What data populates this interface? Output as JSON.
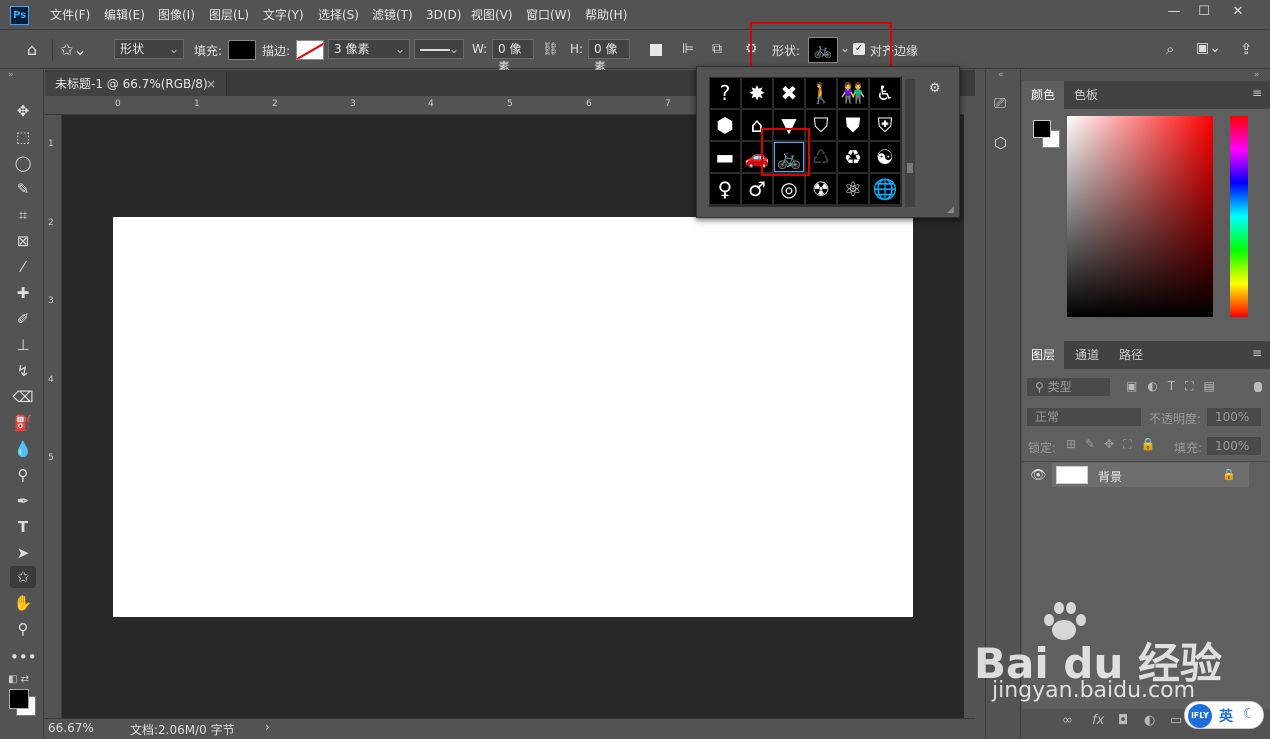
{
  "app": {
    "logo": "Ps"
  },
  "menu": [
    "文件(F)",
    "编辑(E)",
    "图像(I)",
    "图层(L)",
    "文字(Y)",
    "选择(S)",
    "滤镜(T)",
    "3D(D)",
    "视图(V)",
    "窗口(W)",
    "帮助(H)"
  ],
  "window_controls": {
    "minimize": "—",
    "maximize": "☐",
    "close": "✕"
  },
  "options": {
    "mode_value": "形状",
    "fill_label": "填充:",
    "stroke_label": "描边:",
    "stroke_width": "3 像素",
    "w_label": "W:",
    "w_value": "0 像素",
    "h_label": "H:",
    "h_value": "0 像素",
    "shape_label": "形状:",
    "align_edges_label": "对齐边缘",
    "align_edges_checked": true
  },
  "document": {
    "tab_title": "未标题-1 @ 66.7%(RGB/8)",
    "tab_close": "×",
    "ruler_top": [
      "0",
      "1",
      "2",
      "3",
      "4",
      "5",
      "6",
      "7"
    ],
    "ruler_left": [
      "1",
      "2",
      "3",
      "4",
      "5"
    ],
    "zoom": "66.67%",
    "doc_info": "文档:2.06M/0 字节",
    "status_arrow": "›"
  },
  "shape_picker": {
    "rows": [
      [
        "?",
        "✸",
        "✖",
        "🚶",
        "👫",
        "♿"
      ],
      [
        "⬢",
        "⌂",
        "▼",
        "⛉",
        "⛊",
        "⛨"
      ],
      [
        "▬",
        "🚗",
        "🚲",
        "♺",
        "♻",
        "☯"
      ],
      [
        "♀",
        "♂",
        "◎",
        "☢",
        "⚛",
        "🌐"
      ]
    ],
    "selected": "bicycle",
    "menu_icon": "⚙"
  },
  "color_panel": {
    "tabs": [
      "颜色",
      "色板"
    ],
    "foreground": "#000000",
    "background": "#ffffff",
    "hue_color": "#ff0000"
  },
  "layers_panel": {
    "tabs": [
      "图层",
      "通道",
      "路径"
    ],
    "filter_placeholder": "类型",
    "blend_mode": "正常",
    "opacity_label": "不透明度:",
    "opacity_value": "100%",
    "lock_label": "锁定:",
    "fill_label": "填充:",
    "fill_value": "100%",
    "layers": [
      {
        "name": "背景",
        "visible": true,
        "locked": true
      }
    ]
  },
  "bottom_icons": [
    "∞",
    "fx",
    "◘",
    "◐",
    "▭",
    "⊞",
    "🗑"
  ],
  "watermark": {
    "brand_cn": "Bai du 经验",
    "brand_en": "jingyan.baidu.com"
  },
  "ime": {
    "logo": "iFLY",
    "lang": "英"
  }
}
